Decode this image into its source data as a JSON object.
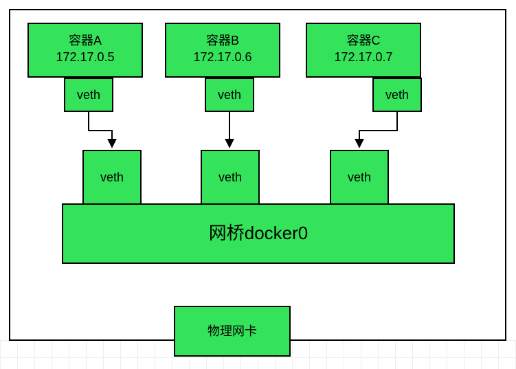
{
  "colors": {
    "box_fill": "#35e35a",
    "border": "#000000"
  },
  "containers": [
    {
      "name": "容器A",
      "ip": "172.17.0.5"
    },
    {
      "name": "容器B",
      "ip": "172.17.0.6"
    },
    {
      "name": "容器C",
      "ip": "172.17.0.7"
    }
  ],
  "veth_label": "veth",
  "bridge_label": "网桥docker0",
  "nic_label": "物理网卡"
}
